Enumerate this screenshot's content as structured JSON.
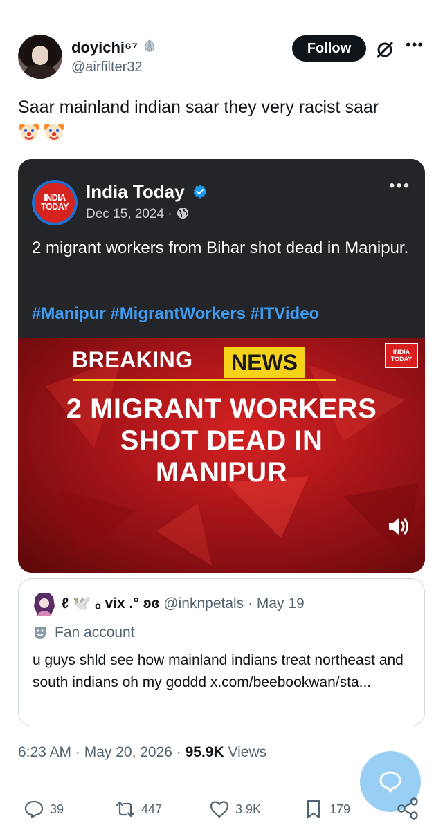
{
  "author": {
    "display_name": "doyichi⁶⁷",
    "handle": "@airfilter32",
    "avatar_icon": "avatar",
    "badge_icon": "shell-icon"
  },
  "header": {
    "follow_label": "Follow",
    "grok_icon": "grok-icon",
    "more_icon": "more-icon"
  },
  "tweet": {
    "text": "Saar mainland indian saar they very racist saar",
    "emojis": [
      "clown-face",
      "clown-face"
    ]
  },
  "embedded_post": {
    "source_name": "India Today",
    "logo_text_1": "INDIA",
    "logo_text_2": "TODAY",
    "date": "Dec 15, 2024 ·",
    "text": "2 migrant workers from Bihar shot dead in Manipur.",
    "hashtags": "#Manipur #MigrantWorkers #ITVideo",
    "video": {
      "banner_left": "BREAKING",
      "banner_right": "NEWS",
      "headline_line1": "2 MIGRANT WORKERS",
      "headline_line2": "SHOT DEAD IN",
      "headline_line3": "MANIPUR",
      "corner_logo_1": "INDIA",
      "corner_logo_2": "TODAY"
    }
  },
  "quoted_post": {
    "name": "ℓ  🕊️ ₒ vix  .° ʚɞ",
    "handle": "@inknpetals",
    "date": "· May 19",
    "label": "Fan account",
    "text": "u guys shld see how mainland indians treat northeast and south indians oh my goddd x.com/beebookwan/sta..."
  },
  "meta": {
    "time": "6:23 AM · May 20, 2026 · ",
    "views_count": "95.9K",
    "views_label": " Views"
  },
  "actions": {
    "replies": "39",
    "reposts": "447",
    "likes": "3.9K",
    "bookmarks": "179"
  },
  "colors": {
    "accent": "#1d9bf0",
    "text": "#0f1419",
    "muted": "#536471",
    "card_bg": "#242529",
    "hashtag": "#3f9cf2",
    "breaking_red": "#b0171b",
    "news_yellow": "#f6d21b"
  }
}
